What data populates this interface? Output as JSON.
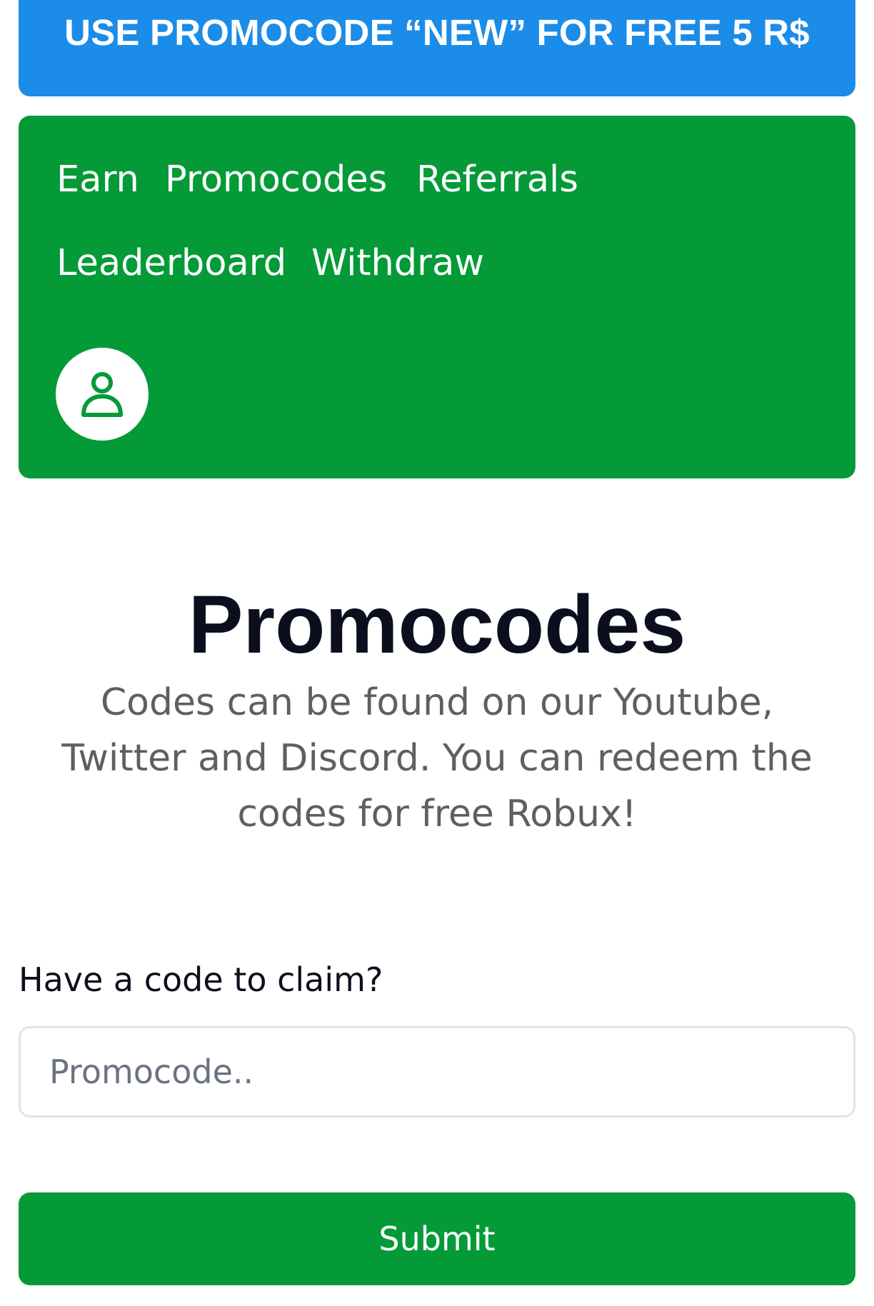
{
  "banner": {
    "text": "USE PROMOCODE “NEW” FOR FREE 5 R$"
  },
  "nav": {
    "items": [
      {
        "label": "Earn"
      },
      {
        "label": "Promocodes"
      },
      {
        "label": "Referrals"
      },
      {
        "label": "Leaderboard"
      },
      {
        "label": "Withdraw"
      }
    ],
    "profile_icon": "user-icon"
  },
  "main": {
    "title": "Promocodes",
    "description": "Codes can be found on our Youtube, Twitter and Discord. You can redeem the codes for free Robux!"
  },
  "form": {
    "label": "Have a code to claim?",
    "input_value": "",
    "input_placeholder": "Promocode..",
    "submit_label": "Submit"
  },
  "colors": {
    "banner": "#1b8ce8",
    "accent_green": "#049a38",
    "title_text": "#0b0f1d",
    "description_text": "#5f5f5f"
  }
}
